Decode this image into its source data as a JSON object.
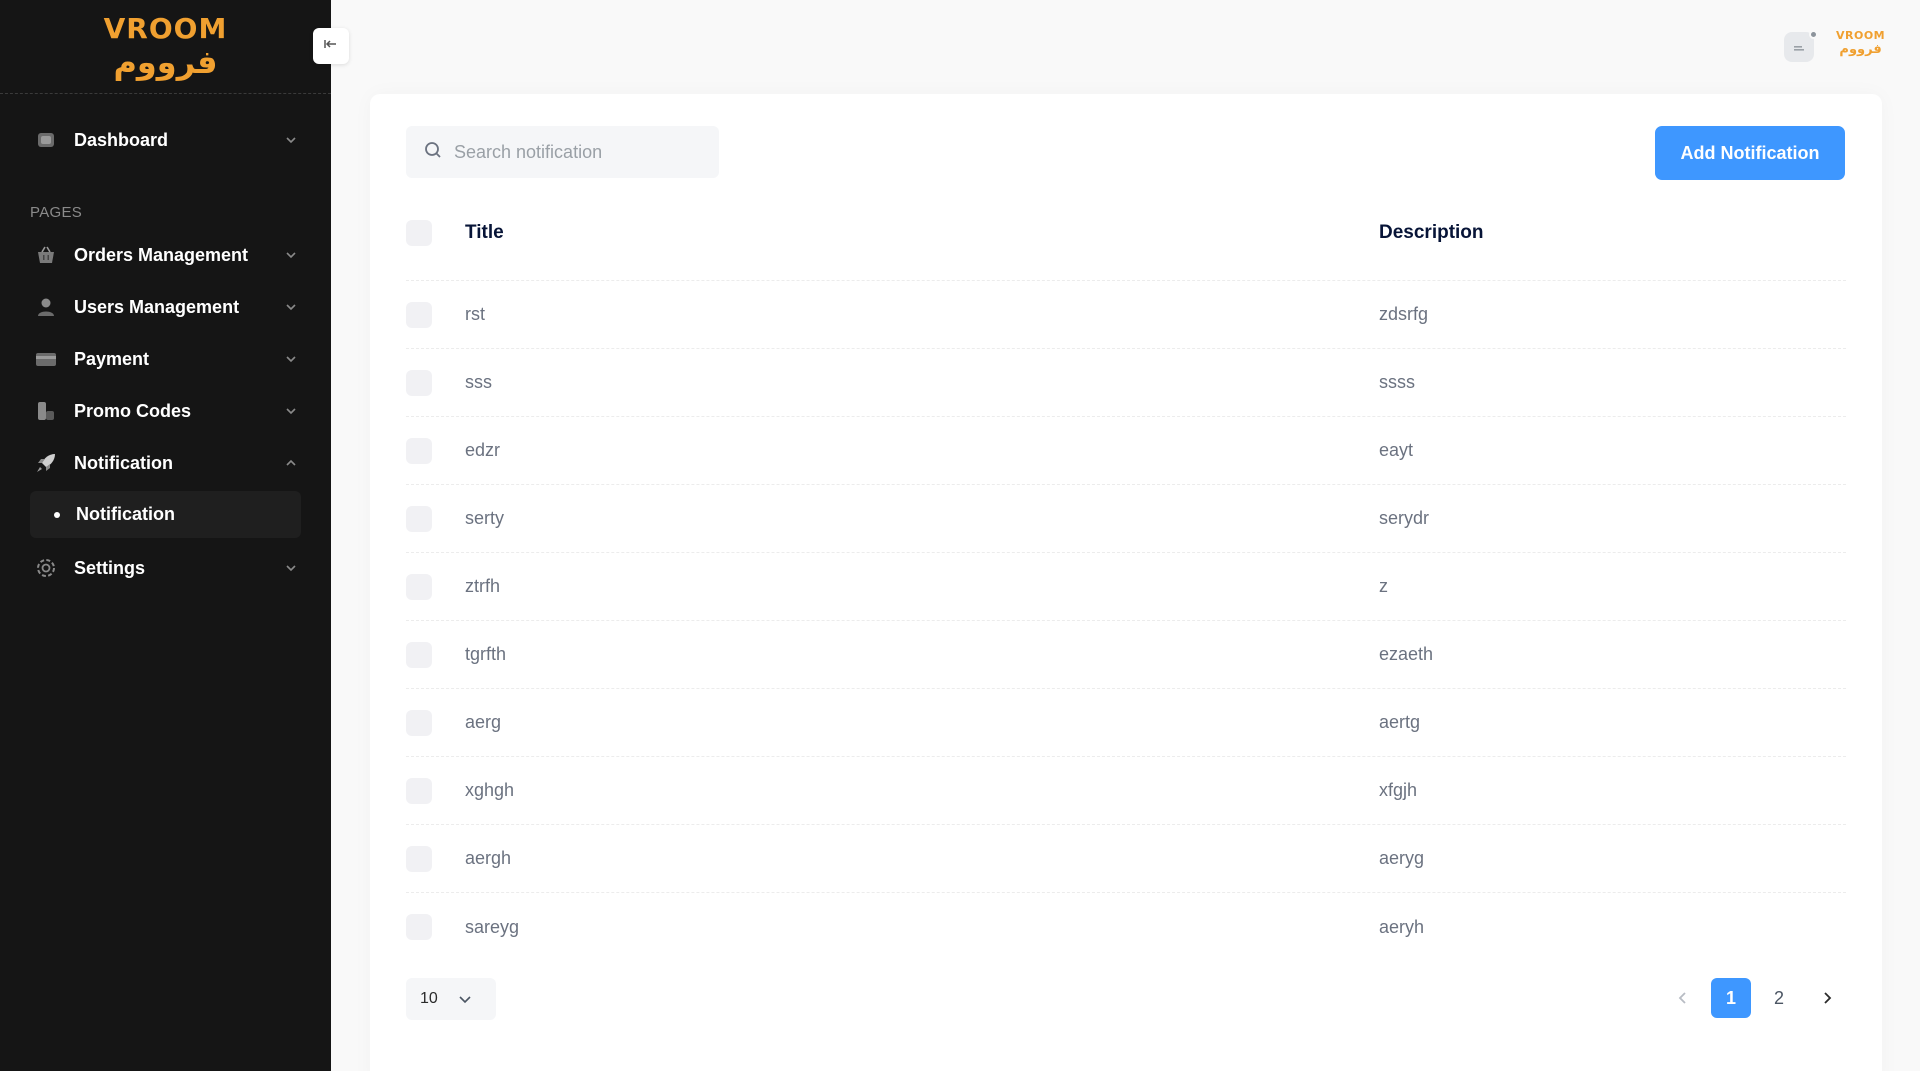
{
  "brand": {
    "latin": "VROOM",
    "arabic": "فرووم",
    "color": "#f0a030"
  },
  "sidebar": {
    "dashboard": "Dashboard",
    "section_label": "PAGES",
    "items": [
      {
        "label": "Orders Management",
        "icon": "basket-icon"
      },
      {
        "label": "Users Management",
        "icon": "user-icon"
      },
      {
        "label": "Payment",
        "icon": "credit-card-icon"
      },
      {
        "label": "Promo Codes",
        "icon": "promo-code-icon"
      },
      {
        "label": "Notification",
        "icon": "rocket-icon",
        "expanded": true
      }
    ],
    "sub_items": [
      {
        "label": "Notification",
        "active": true
      }
    ],
    "settings": "Settings"
  },
  "header": {
    "mini_logo_latin": "VROOM",
    "mini_logo_arabic": "فرووم"
  },
  "toolbar": {
    "search_placeholder": "Search notification",
    "add_button": "Add Notification",
    "accent": "#3e97ff"
  },
  "table": {
    "columns": [
      "Title",
      "Description"
    ],
    "rows": [
      {
        "title": "rst",
        "description": "zdsrfg"
      },
      {
        "title": "sss",
        "description": "ssss"
      },
      {
        "title": "edzr",
        "description": "eayt"
      },
      {
        "title": "serty",
        "description": "serydr"
      },
      {
        "title": "ztrfh",
        "description": "z"
      },
      {
        "title": "tgrfth",
        "description": "ezaeth"
      },
      {
        "title": "aerg",
        "description": "aertg"
      },
      {
        "title": "xghgh",
        "description": "xfgjh"
      },
      {
        "title": "aergh",
        "description": "aeryg"
      },
      {
        "title": "sareyg",
        "description": "aeryh"
      }
    ]
  },
  "pagination": {
    "page_size": "10",
    "pages": [
      "1",
      "2"
    ],
    "current": "1"
  }
}
